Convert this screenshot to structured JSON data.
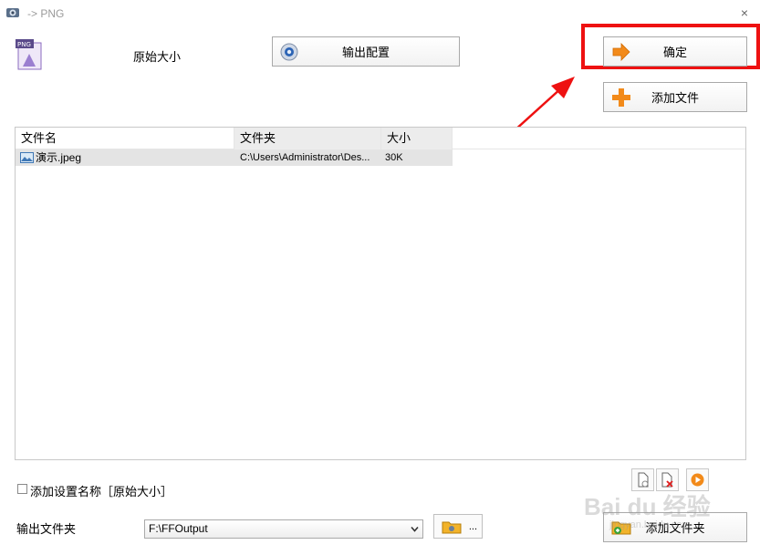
{
  "window": {
    "title": "-> PNG",
    "close_icon": "×"
  },
  "top": {
    "preset_label": "原始大小",
    "output_config_label": "输出配置",
    "ok_label": "确定",
    "add_file_label": "添加文件"
  },
  "list": {
    "headers": [
      "文件名",
      "文件夹",
      "大小"
    ],
    "rows": [
      {
        "name": "演示.jpeg",
        "folder": "C:\\Users\\Administrator\\Des...",
        "size": "30K"
      }
    ]
  },
  "bottom": {
    "checkbox_label": "添加设置名称［原始大小］",
    "output_folder_label": "输出文件夹",
    "output_folder_value": "F:\\FFOutput",
    "browse_dots": "...",
    "add_folder_label": "添加文件夹"
  },
  "watermark": {
    "text": "Bai du 经验",
    "url": "jingyan.baidu.com"
  },
  "colors": {
    "highlight_red": "#ee1111",
    "accent_orange": "#f28a1a"
  }
}
